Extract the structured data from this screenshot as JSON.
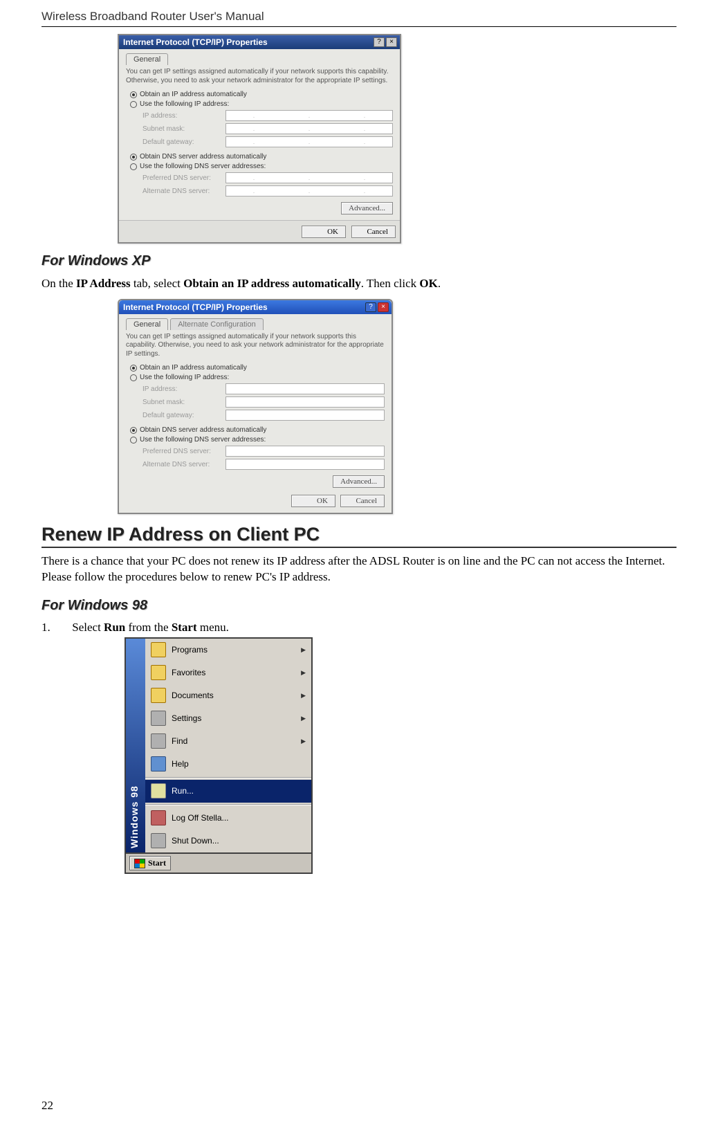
{
  "header": {
    "title": "Wireless Broadband Router User's Manual"
  },
  "dialog2k": {
    "title": "Internet Protocol (TCP/IP) Properties",
    "tab": "General",
    "desc": "You can get IP settings assigned automatically if your network supports this capability. Otherwise, you need to ask your network administrator for the appropriate IP settings.",
    "opt_obtain_ip": "Obtain an IP address automatically",
    "opt_use_ip": "Use the following IP address:",
    "lbl_ip": "IP address:",
    "lbl_mask": "Subnet mask:",
    "lbl_gw": "Default gateway:",
    "opt_obtain_dns": "Obtain DNS server address automatically",
    "opt_use_dns": "Use the following DNS server addresses:",
    "lbl_pref_dns": "Preferred DNS server:",
    "lbl_alt_dns": "Alternate DNS server:",
    "btn_adv": "Advanced...",
    "btn_ok": "OK",
    "btn_cancel": "Cancel"
  },
  "section_xp_heading": "For Windows XP",
  "para_xp_pre": "On the ",
  "para_xp_b1": "IP Address",
  "para_xp_mid1": " tab, select ",
  "para_xp_b2": "Obtain an IP address automatically",
  "para_xp_mid2": ". Then click ",
  "para_xp_b3": "OK",
  "para_xp_end": ".",
  "dialogxp": {
    "title": "Internet Protocol (TCP/IP) Properties",
    "tab1": "General",
    "tab2": "Alternate Configuration",
    "desc": "You can get IP settings assigned automatically if your network supports this capability. Otherwise, you need to ask your network administrator for the appropriate IP settings.",
    "opt_obtain_ip": "Obtain an IP address automatically",
    "opt_use_ip": "Use the following IP address:",
    "lbl_ip": "IP address:",
    "lbl_mask": "Subnet mask:",
    "lbl_gw": "Default gateway:",
    "opt_obtain_dns": "Obtain DNS server address automatically",
    "opt_use_dns": "Use the following DNS server addresses:",
    "lbl_pref_dns": "Preferred DNS server:",
    "lbl_alt_dns": "Alternate DNS server:",
    "btn_adv": "Advanced...",
    "btn_ok": "OK",
    "btn_cancel": "Cancel"
  },
  "renew_heading": "Renew IP Address on Client PC",
  "renew_para": "There is a chance that your PC does not renew its IP address after the ADSL Router is on line and the PC can not access the Internet. Please follow the procedures below to renew PC's IP address.",
  "section_98_heading": "For Windows 98",
  "step1_num": "1.",
  "step1_pre": "Select ",
  "step1_b1": "Run",
  "step1_mid": " from the ",
  "step1_b2": "Start",
  "step1_end": " menu.",
  "startmenu": {
    "brand": "Windows 98",
    "items": [
      {
        "label": "Programs",
        "icon": "folder",
        "arrow": true
      },
      {
        "label": "Favorites",
        "icon": "folder",
        "arrow": true
      },
      {
        "label": "Documents",
        "icon": "folder",
        "arrow": true
      },
      {
        "label": "Settings",
        "icon": "grey",
        "arrow": true
      },
      {
        "label": "Find",
        "icon": "grey",
        "arrow": true
      },
      {
        "label": "Help",
        "icon": "blue",
        "arrow": false
      }
    ],
    "run": "Run...",
    "logoff": "Log Off Stella...",
    "shutdown": "Shut Down...",
    "start": "Start"
  },
  "page_number": "22"
}
